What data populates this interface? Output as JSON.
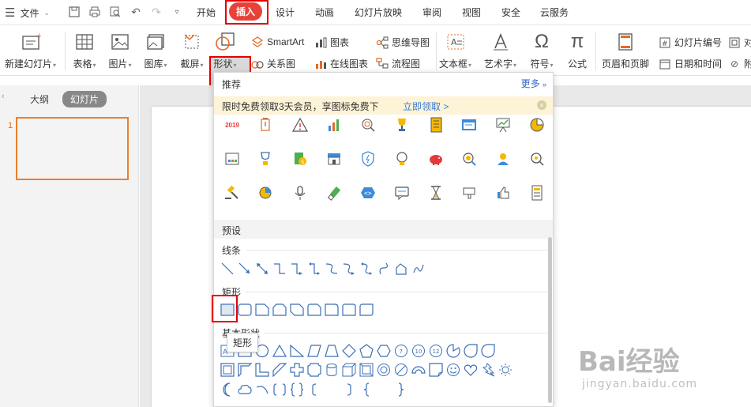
{
  "menubar": {
    "file_label": "文件",
    "tabs": [
      "开始",
      "插入",
      "设计",
      "动画",
      "幻灯片放映",
      "审阅",
      "视图",
      "安全",
      "云服务"
    ],
    "active_tab": "插入"
  },
  "ribbon": {
    "new_slide": "新建幻灯片",
    "table": "表格",
    "image": "图片",
    "gallery": "图库",
    "screenshot": "截屏",
    "shape": "形状",
    "smartart": "SmartArt",
    "relation": "关系图",
    "chart": "图表",
    "online_chart": "在线图表",
    "mindmap": "思维导图",
    "flowchart": "流程图",
    "textbox": "文本框",
    "wordart": "艺术字",
    "symbol": "符号",
    "formula": "公式",
    "header_footer": "页眉和页脚",
    "slide_number": "幻灯片编号",
    "datetime": "日期和时间",
    "object_partial": "对",
    "attach_partial": "附"
  },
  "left_panel": {
    "outline_tab": "大纲",
    "slides_tab": "幻灯片",
    "slide_number": "1"
  },
  "dropdown": {
    "recommend_label": "推荐",
    "more_label": "更多",
    "promo_text": "限时免费领取3天会员，享图标免费下",
    "promo_link": "立即领取 >",
    "year_icon_text": "2019",
    "preset_label": "预设",
    "lines_label": "线条",
    "rect_label": "矩形",
    "basic_label": "基本形状",
    "tooltip": "矩形",
    "basic_numbers": [
      "7",
      "10",
      "12"
    ],
    "basic_text_icon": "A"
  },
  "colors": {
    "accent_red": "#e8413a",
    "highlight_border": "#e60000",
    "link_blue": "#3366cc",
    "promo_bg": "#fdf3d6",
    "shape_stroke": "#3d6fb5"
  },
  "watermark": {
    "brand": "Bai经验",
    "url": "jingyan.baidu.com"
  }
}
